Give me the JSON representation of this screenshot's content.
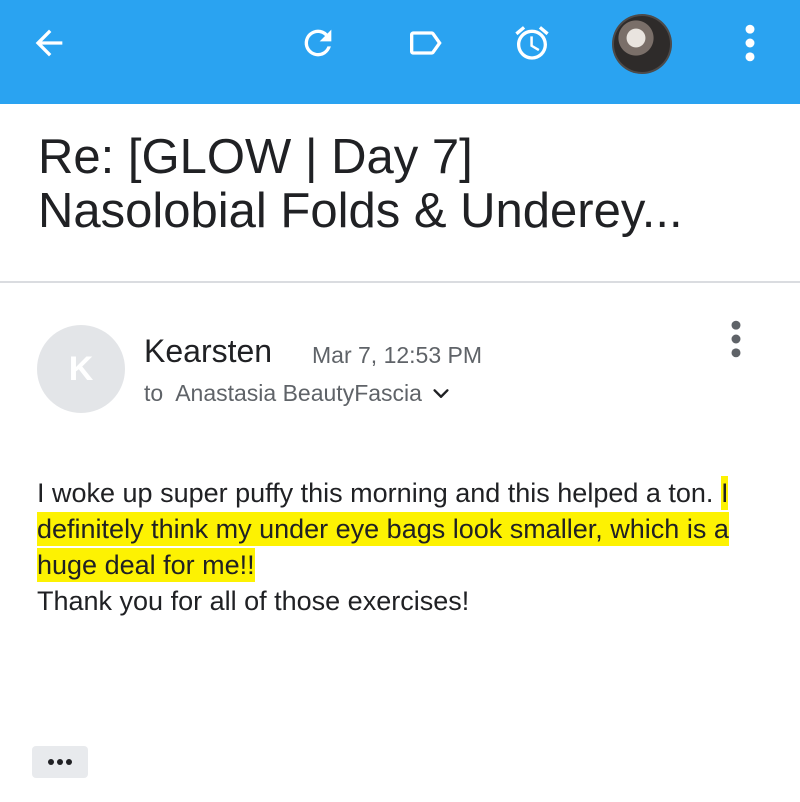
{
  "topbar": {
    "background_color": "#2aa3f1",
    "icons": [
      "back-arrow-icon",
      "refresh-icon",
      "label-icon",
      "snooze-alarm-icon",
      "account-avatar",
      "more-vert-icon"
    ]
  },
  "subject": {
    "line1": "Re: [GLOW | Day 7]",
    "line2": "Nasolobial Folds & Underey..."
  },
  "message": {
    "avatar_initial": "K",
    "sender_name": "Kearsten",
    "date": "Mar 7, 12:53 PM",
    "to_label": "to",
    "recipient": "Anastasia BeautyFascia",
    "body_plain_1": "I woke up super puffy this morning and this helped a ton. ",
    "body_highlight": "I definitely think my under eye bags look smaller, which is a huge deal for me!!",
    "body_plain_2": "Thank you for all of those exercises!",
    "highlight_color": "#fdf202"
  }
}
